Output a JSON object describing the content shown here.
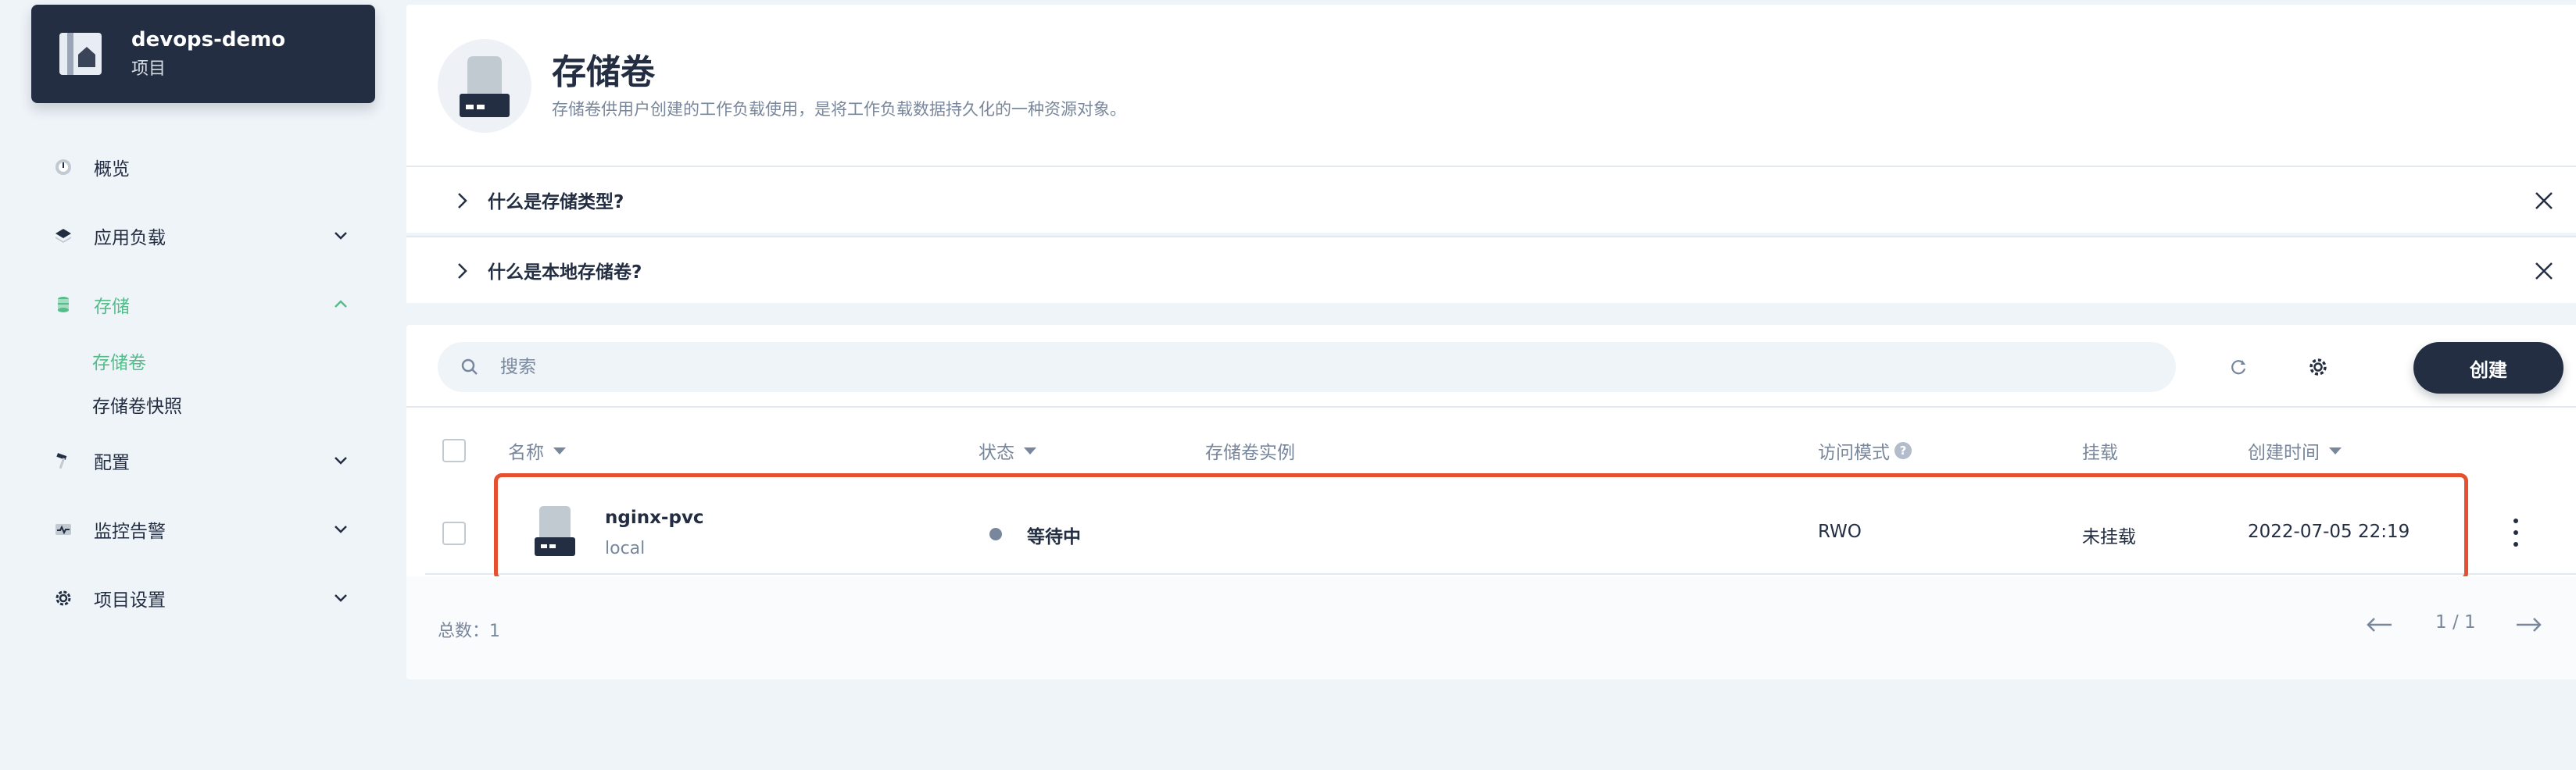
{
  "project": {
    "name": "devops-demo",
    "type": "项目"
  },
  "sidebar": {
    "items": [
      {
        "label": "概览",
        "icon": "dashboard-icon",
        "active": false,
        "expandable": false
      },
      {
        "label": "应用负载",
        "icon": "layers-icon",
        "active": false,
        "expandable": true
      },
      {
        "label": "存储",
        "icon": "database-icon",
        "active": true,
        "expandable": true,
        "expanded": true
      },
      {
        "label": "配置",
        "icon": "hammer-icon",
        "active": false,
        "expandable": true
      },
      {
        "label": "监控告警",
        "icon": "monitor-icon",
        "active": false,
        "expandable": true
      },
      {
        "label": "项目设置",
        "icon": "gear-icon",
        "active": false,
        "expandable": true
      }
    ],
    "storage_children": [
      {
        "label": "存储卷",
        "active": true
      },
      {
        "label": "存储卷快照",
        "active": false
      }
    ]
  },
  "header": {
    "title": "存储卷",
    "description": "存储卷供用户创建的工作负载使用，是将工作负载数据持久化的一种资源对象。"
  },
  "faq": [
    {
      "label": "什么是存储类型?"
    },
    {
      "label": "什么是本地存储卷?"
    }
  ],
  "toolbar": {
    "search_placeholder": "搜索",
    "create_label": "创建"
  },
  "table": {
    "columns": {
      "name": "名称",
      "status": "状态",
      "volume_instance": "存储卷实例",
      "access_mode": "访问模式",
      "access_mode_help": "?",
      "mount": "挂载",
      "created": "创建时间"
    },
    "rows": [
      {
        "name": "nginx-pvc",
        "storage_class": "local",
        "status": "等待中",
        "volume_instance": "",
        "access_mode": "RWO",
        "mount": "未挂载",
        "created": "2022-07-05 22:19"
      }
    ],
    "total_label": "总数：1",
    "page": "1 / 1"
  },
  "colors": {
    "accent_green": "#55bc8a",
    "dark": "#242e42",
    "muted": "#79879c",
    "highlight_border": "#e5512f",
    "background": "#eff4f9"
  }
}
